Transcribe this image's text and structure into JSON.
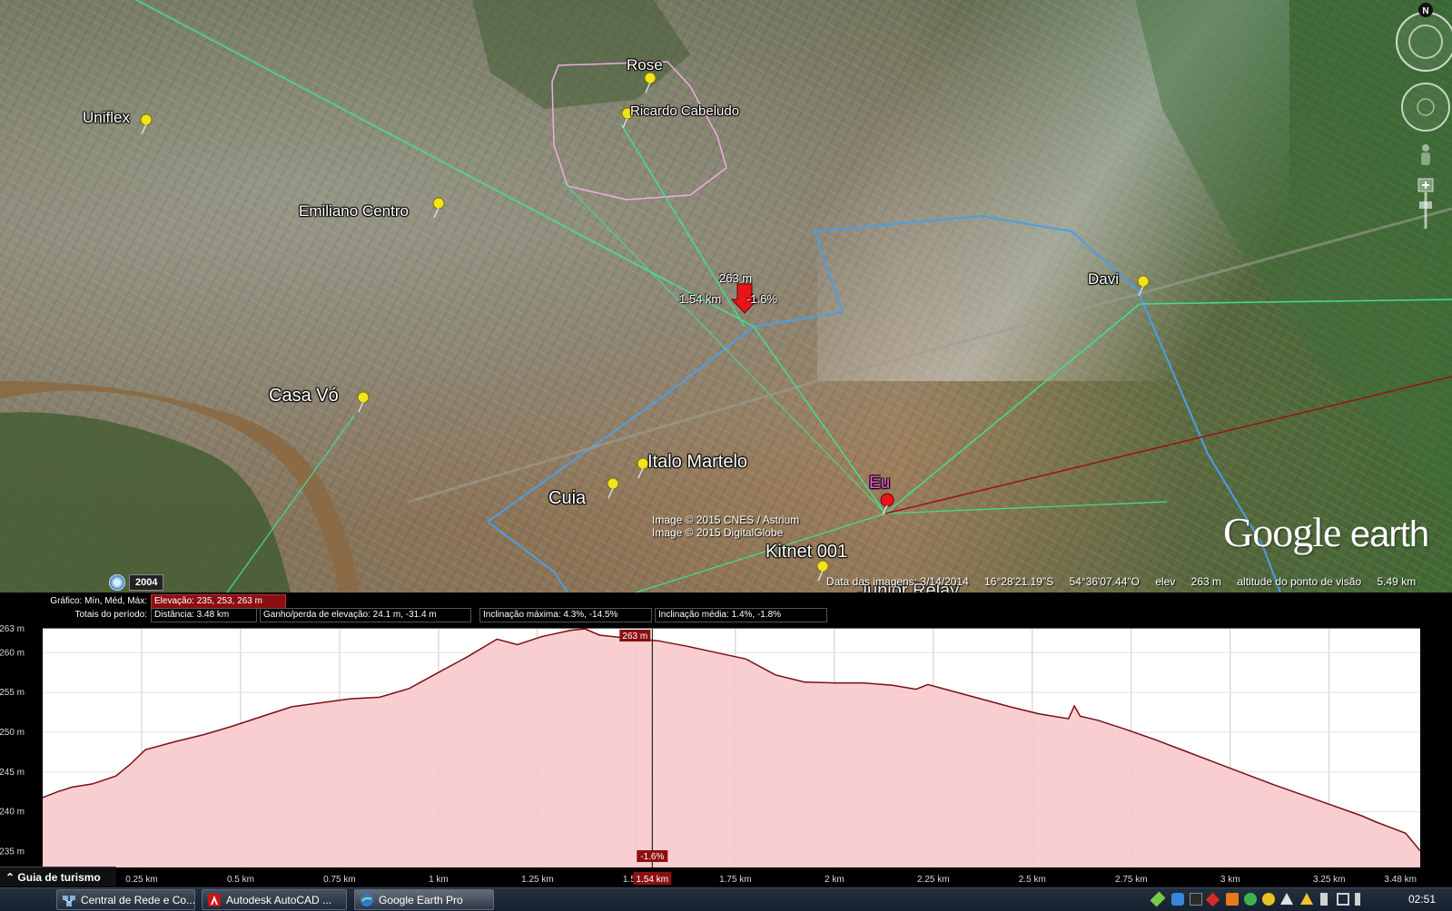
{
  "map": {
    "placemarks": [
      {
        "label": "Rose"
      },
      {
        "label": "Ricardo Cabeludo"
      },
      {
        "label": "Uniflex"
      },
      {
        "label": "Emiliano Centro"
      },
      {
        "label": "Davi"
      },
      {
        "label": "Casa Vó"
      },
      {
        "label": "Italo Martelo"
      },
      {
        "label": "Cuia"
      },
      {
        "label": "Eu"
      },
      {
        "label": "Kitnet 001"
      },
      {
        "label": "Junior Relay"
      }
    ],
    "pin_colors": {
      "placemark": "#f2e31a",
      "current": "#e8141b"
    },
    "path_colors": {
      "green": "#3fe08f",
      "blue": "#4a9ee8",
      "pink": "#f2a8e6",
      "dark_red": "#a01010"
    },
    "measure": {
      "elevation": "263 m",
      "distance": "1.54 km",
      "slope": "-1.6%"
    },
    "credits": {
      "line1": "Image © 2015 CNES / Astrium",
      "line2": "Image © 2015 DigitalGlobe"
    },
    "logo": {
      "word1": "Google",
      "word2": "earth"
    },
    "year_badge": "2004",
    "compass_letter": "N",
    "status": {
      "imagery_date": "Data das imagens: 3/14/2014",
      "lat": "16°28'21.19\"S",
      "lon": "54°36'07.44\"O",
      "elev_label": "elev",
      "elev_value": "263 m",
      "eye_label": "altitude do ponto de visão",
      "eye_value": "5.49 km"
    }
  },
  "profile": {
    "row1": {
      "label": "Gráfico: Mín, Méd, Máx:",
      "elevation": "Elevação: 235, 253, 263 m"
    },
    "row2": {
      "label": "Totais do período:",
      "distance": "Distância: 3.48 km",
      "gain_loss": "Ganho/perda de elevação: 24.1 m, -31.4 m",
      "max_slope": "Inclinação máxima: 4.3%, -14.5%",
      "avg_slope": "Inclinação média: 1.4%, -1.8%"
    },
    "cursor": {
      "elevation_label": "263 m",
      "slope_label": "-1.6%",
      "distance_label": "1.54 km",
      "distance_km": 1.54
    },
    "tour_guide": "Guia de turismo"
  },
  "chart_data": {
    "type": "area",
    "title": "",
    "xlabel": "",
    "ylabel": "",
    "xlim": [
      0,
      3.48
    ],
    "ylim": [
      233,
      263
    ],
    "grid": true,
    "x_ticks": [
      {
        "value": 0.25,
        "label": "0.25 km"
      },
      {
        "value": 0.5,
        "label": "0.5 km"
      },
      {
        "value": 0.75,
        "label": "0.75 km"
      },
      {
        "value": 1.0,
        "label": "1 km"
      },
      {
        "value": 1.25,
        "label": "1.25 km"
      },
      {
        "value": 1.5,
        "label": "1.5 km"
      },
      {
        "value": 1.75,
        "label": "1.75 km"
      },
      {
        "value": 2.0,
        "label": "2 km"
      },
      {
        "value": 2.25,
        "label": "2.25 km"
      },
      {
        "value": 2.5,
        "label": "2.5 km"
      },
      {
        "value": 2.75,
        "label": "2.75 km"
      },
      {
        "value": 3.0,
        "label": "3 km"
      },
      {
        "value": 3.25,
        "label": "3.25 km"
      },
      {
        "value": 3.48,
        "label": "3.48 km"
      }
    ],
    "y_ticks": [
      {
        "value": 235,
        "label": "235 m"
      },
      {
        "value": 240,
        "label": "240 m"
      },
      {
        "value": 245,
        "label": "245 m"
      },
      {
        "value": 250,
        "label": "250 m"
      },
      {
        "value": 255,
        "label": "255 m"
      },
      {
        "value": 260,
        "label": "260 m"
      },
      {
        "value": 263,
        "label": "263 m"
      }
    ],
    "series": [
      {
        "color": "#7a0f14",
        "fill": "#f7c9cb",
        "points": [
          [
            0.0,
            241.8
          ],
          [
            0.05,
            242.5
          ],
          [
            0.1,
            243.1
          ],
          [
            0.17,
            243.5
          ],
          [
            0.25,
            244.5
          ],
          [
            0.3,
            246.0
          ],
          [
            0.35,
            247.8
          ],
          [
            0.45,
            248.8
          ],
          [
            0.55,
            249.7
          ],
          [
            0.65,
            250.8
          ],
          [
            0.75,
            252.0
          ],
          [
            0.85,
            253.2
          ],
          [
            0.95,
            253.7
          ],
          [
            1.05,
            254.2
          ],
          [
            1.15,
            254.4
          ],
          [
            1.25,
            255.5
          ],
          [
            1.35,
            257.5
          ],
          [
            1.45,
            259.5
          ],
          [
            1.55,
            261.7
          ],
          [
            1.62,
            261.0
          ],
          [
            1.7,
            262.0
          ],
          [
            1.8,
            262.8
          ],
          [
            1.85,
            263.0
          ],
          [
            1.9,
            262.2
          ],
          [
            2.0,
            261.8
          ],
          [
            2.1,
            261.5
          ],
          [
            2.2,
            260.8
          ],
          [
            2.3,
            260.0
          ],
          [
            2.4,
            259.2
          ],
          [
            2.5,
            257.2
          ],
          [
            2.6,
            256.3
          ],
          [
            2.7,
            256.2
          ],
          [
            2.8,
            256.2
          ],
          [
            2.9,
            255.9
          ],
          [
            2.98,
            255.4
          ],
          [
            3.02,
            256.0
          ],
          [
            3.1,
            255.2
          ],
          [
            3.2,
            254.2
          ],
          [
            3.3,
            253.2
          ],
          [
            3.4,
            252.3
          ],
          [
            3.5,
            251.7
          ],
          [
            3.52,
            253.3
          ],
          [
            3.54,
            252.0
          ],
          [
            3.6,
            251.5
          ],
          [
            3.7,
            250.3
          ],
          [
            3.8,
            249.0
          ],
          [
            3.9,
            247.6
          ],
          [
            4.0,
            246.2
          ],
          [
            4.1,
            244.8
          ],
          [
            4.2,
            243.4
          ],
          [
            4.3,
            242.1
          ],
          [
            4.4,
            240.8
          ],
          [
            4.5,
            239.5
          ],
          [
            4.55,
            238.7
          ],
          [
            4.65,
            237.3
          ],
          [
            4.7,
            235.1
          ]
        ]
      }
    ],
    "x_scale_note": "points x-values are in the chart's own distance units scaled so that 4.7 corresponds to 3.48 km"
  },
  "taskbar": {
    "tasks": [
      {
        "label": "Central de Rede e Co...",
        "icon": "network-icon"
      },
      {
        "label": "Autodesk AutoCAD ...",
        "icon": "autocad-icon"
      },
      {
        "label": "Google Earth Pro",
        "icon": "google-earth-icon"
      }
    ],
    "clock": "02:51"
  }
}
